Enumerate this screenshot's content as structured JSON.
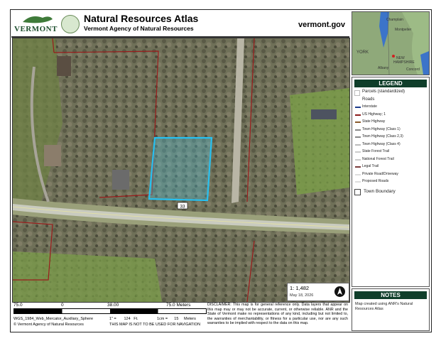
{
  "header": {
    "title": "Natural Resources Atlas",
    "subtitle": "Vermont Agency of Natural Resources",
    "site": "vermont.gov",
    "logo_text": "VERMONT"
  },
  "map": {
    "road_shield": "33"
  },
  "locator": {
    "labels": [
      "Champlain",
      "Montpelier",
      "YORK",
      "NEW",
      "HAMPSHIRE",
      "Albany",
      "Concord"
    ]
  },
  "legend": {
    "title": "LEGEND",
    "items": [
      {
        "label": "Parcels (standardized)",
        "kind": "box-header"
      },
      {
        "label": "Roads",
        "kind": "header"
      },
      {
        "label": "Interstate",
        "color": "#1b3b8c"
      },
      {
        "label": "US Highway; 1",
        "color": "#8b1a1a"
      },
      {
        "label": "State Highway",
        "color": "#8a5a2b"
      },
      {
        "label": "Town Highway (Class 1)",
        "color": "#888888"
      },
      {
        "label": "Town Highway (Class 2,3)",
        "color": "#888888"
      },
      {
        "label": "Town Highway (Class 4)",
        "color": "#bbbbbb"
      },
      {
        "label": "State Forest Trail",
        "color": "#cccccc"
      },
      {
        "label": "National Forest Trail",
        "color": "#cccccc"
      },
      {
        "label": "Legal Trail",
        "color": "#7a3b3b"
      },
      {
        "label": "Private Road/Driveway",
        "color": "#dddddd"
      },
      {
        "label": "Proposed Roads",
        "color": "#dddddd"
      },
      {
        "label": "Town Boundary",
        "kind": "box-big"
      }
    ]
  },
  "notes": {
    "title": "NOTES",
    "text": "Map created using ANR's Natural Resources Atlas"
  },
  "scale": {
    "ratio": "1:  1,482",
    "date": "May 18, 2026"
  },
  "footer": {
    "bar_left": "75.0",
    "bar_zero": "0",
    "bar_mid": "38.00",
    "bar_right": "75.0 Meters",
    "projection": "WGS_1984_Web_Mercator_Auxiliary_Sphere",
    "copyright": "© Vermont Agency of Natural Resources",
    "inch_eq": "1\" =       124   Ft.",
    "cm_eq": "1cm =      15     Meters",
    "nav_warning": "THIS MAP IS NOT TO BE USED FOR NAVIGATION",
    "disclaimer": "DISCLAIMER: This map is for general reference only. Data layers that appear on this map may or may not be accurate, current, or otherwise reliable. ANR and the State of Vermont make no representations of any kind, including but not limited to, the warranties of merchantability, or fitness for a particular use, nor are any such warranties to be implied with respect to the data on this map."
  }
}
